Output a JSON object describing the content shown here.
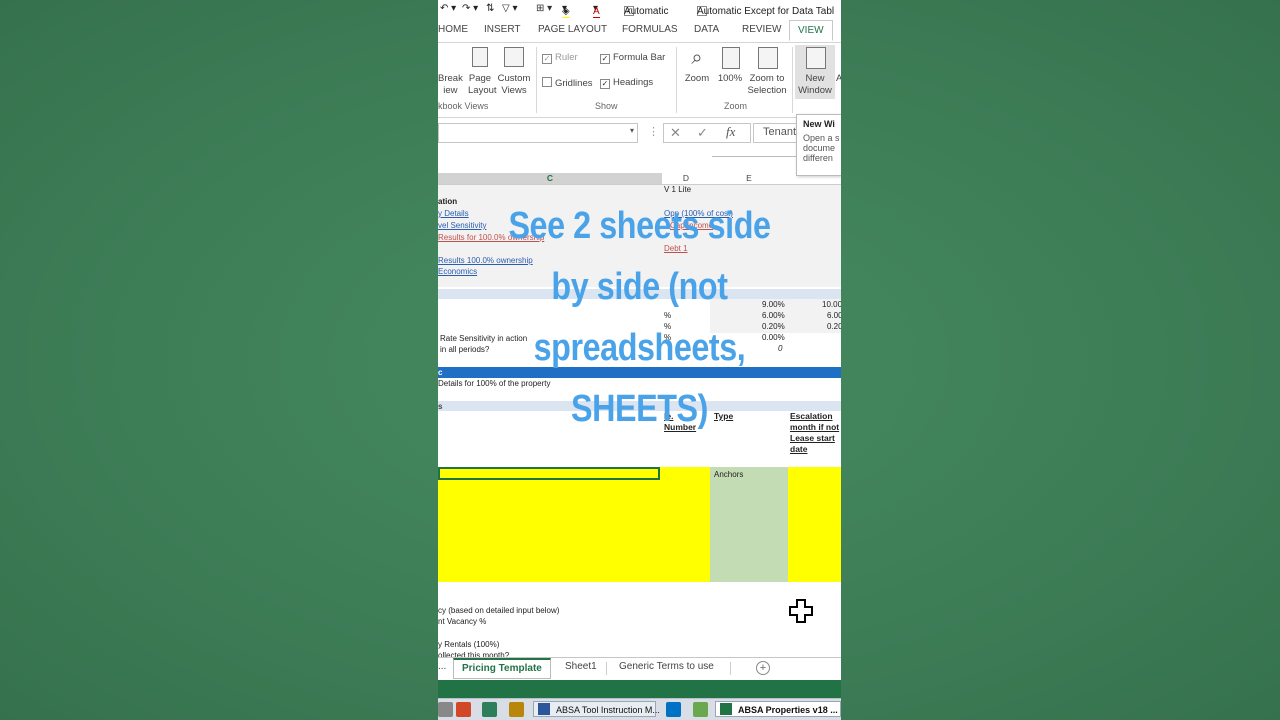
{
  "qat": {
    "automatic": "Automatic",
    "automatic_except": "Automatic Except for Data Tabl"
  },
  "tabs": [
    "HOME",
    "INSERT",
    "PAGE LAYOUT",
    "FORMULAS",
    "DATA",
    "REVIEW",
    "VIEW"
  ],
  "active_tab": "VIEW",
  "ribbon": {
    "page_break": [
      "Break",
      "iew"
    ],
    "page_layout": [
      "Page",
      "Layout"
    ],
    "custom_views": [
      "Custom",
      "Views"
    ],
    "workbook_views_group": "kbook Views",
    "ruler": "Ruler",
    "formula_bar": "Formula Bar",
    "gridlines": "Gridlines",
    "headings": "Headings",
    "show_group": "Show",
    "zoom": "Zoom",
    "zoom100": "100%",
    "zoom_selection": [
      "Zoom to",
      "Selection"
    ],
    "zoom_group": "Zoom",
    "new_window": [
      "New",
      "Window"
    ],
    "arrange": "A"
  },
  "tooltip": {
    "title": "New Wi",
    "lines": [
      "Open a s",
      "docume",
      "differen"
    ]
  },
  "formula_bar": {
    "content": "Tenant"
  },
  "columns": [
    "C",
    "D",
    "E"
  ],
  "cells": {
    "v1lite": "V 1 Lite",
    "ation": "ation",
    "link1": "y Details",
    "link2": "vel Sensitivity",
    "link3": "Results for 100.0% ownership",
    "link4": "Results 100.0% ownership",
    "link5": "Economics",
    "d1": "Opp (100% of cost)",
    "d2": "Cap Income",
    "d3": "Debt 1",
    "pct1": "%",
    "pct2": "%",
    "pct3": "%",
    "e1": "9.00%",
    "e2": "6.00%",
    "e3": "0.20%",
    "e4": "0.00%",
    "e5": "0",
    "f1": "10.00",
    "f2": "6.00",
    "f3": "0.20",
    "rate1": "Rate Sensitivity in action",
    "rate2": "in all periods?",
    "blue_band": "c",
    "details": "Details for 100% of the property",
    "s": "s",
    "hdr_number": [
      "le.",
      "Number"
    ],
    "hdr_type": "Type",
    "hdr_escalation": [
      "Escalation",
      "month if not",
      "Lease start",
      "date"
    ],
    "anchors": "Anchors",
    "bottom1": "cy (based on detailed input below)",
    "bottom2": "nt Vacancy %",
    "bottom3": "y Rentals (100%)",
    "bottom4": "ollected this month?"
  },
  "sheet_tabs": [
    "...",
    "Pricing Template",
    "Sheet1",
    "Generic Terms to use"
  ],
  "active_sheet": "Pricing Template",
  "taskbar": {
    "win1": "ABSA Tool Instruction M...",
    "win2": "ABSA Properties v18 ..."
  },
  "caption": [
    "See 2 sheets side",
    "by side (not",
    "spreadsheets,",
    "SHEETS)"
  ],
  "colors": {
    "excel_green": "#217346",
    "cell_yellow": "#ffff00",
    "anchor_green": "#c4dcb3",
    "caption_blue": "#4aa3e8",
    "background": "#3f7f58"
  }
}
